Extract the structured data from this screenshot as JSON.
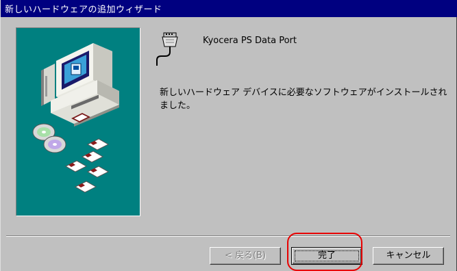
{
  "window": {
    "title": "新しいハードウェアの追加ウィザード"
  },
  "device": {
    "name": "Kyocera PS Data Port",
    "icon": "serial-port-connector-icon"
  },
  "message": "新しいハードウェア デバイスに必要なソフトウェアがインストールされました。",
  "buttons": {
    "back_label": "< 戻る(B)",
    "finish_label": "完了",
    "cancel_label": "キャンセル"
  },
  "colors": {
    "titlebar": "#000080",
    "dialog_bg": "#c0c0c0",
    "wizard_panel": "#008080",
    "annotation": "#e80000"
  }
}
